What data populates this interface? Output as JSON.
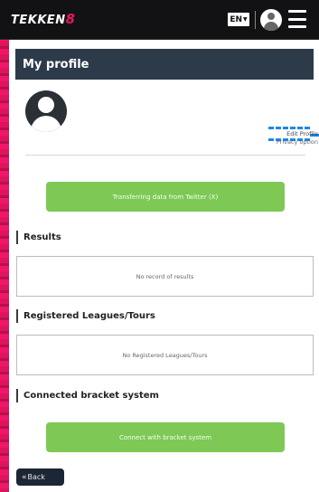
{
  "app": {
    "logo_text": "TEKKEN",
    "logo_number": "8",
    "language": "EN",
    "brand_color": "#e2175f"
  },
  "profile": {
    "page_title": "My profile",
    "edit_profile_link": "Edit Profile",
    "privacy_link": "Privacy option",
    "transfer_button": "Transferring data from Twitter (X)"
  },
  "sections": {
    "results_title": "Results",
    "results_empty": "No record of results",
    "leagues_title": "Registered Leagues/Tours",
    "leagues_empty": "No Registered Leagues/Tours",
    "bracket_title": "Connected bracket system",
    "bracket_button": "Connect with bracket system"
  },
  "nav": {
    "back_label": "Back"
  },
  "icons": {
    "language_caret": "chevron-down-icon",
    "user": "user-icon",
    "menu": "hamburger-menu-icon",
    "back": "double-chevron-left-icon"
  },
  "colors": {
    "header_bar": "#2d3a4a",
    "action_green": "#7ec855",
    "back_button": "#1d2634"
  }
}
